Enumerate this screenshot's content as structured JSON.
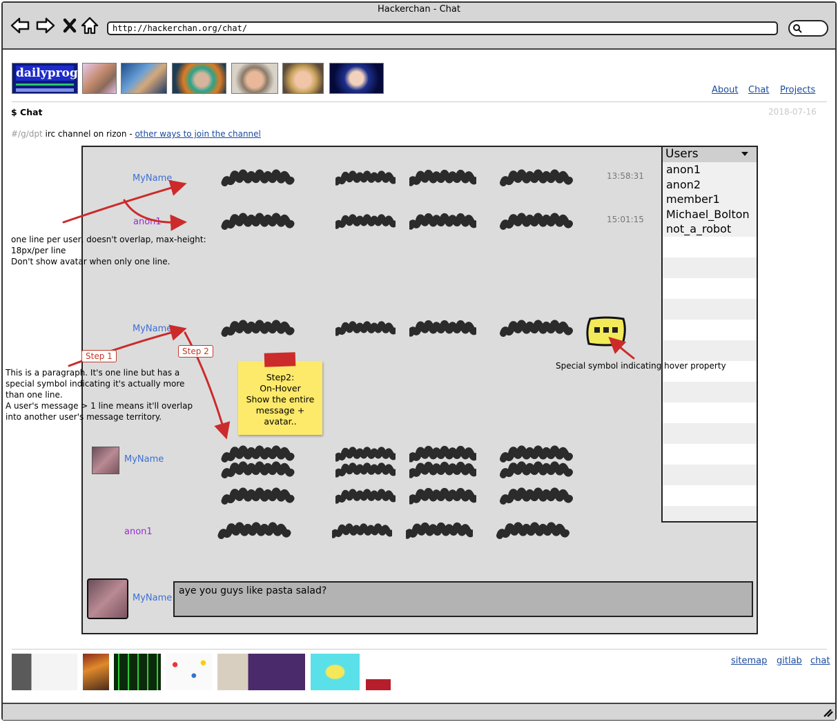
{
  "window": {
    "title": "Hackerchan - Chat",
    "url": "http://hackerchan.org/chat/"
  },
  "header": {
    "logo_text": "dailyprog",
    "nav": [
      {
        "label": "About"
      },
      {
        "label": "Chat"
      },
      {
        "label": "Projects"
      }
    ]
  },
  "page": {
    "title": "$ Chat",
    "date": "2018-07-16",
    "channel_prefix": "#/g/dpt",
    "channel_text": " irc channel on rizon - ",
    "channel_link": "other ways to join the channel"
  },
  "chat": {
    "messages": [
      {
        "name": "MyName",
        "time": "13:58:31"
      },
      {
        "name": "anon1",
        "time": "15:01:15"
      },
      {
        "name": "MyName"
      },
      {
        "name": "MyName"
      },
      {
        "name": "anon1"
      }
    ],
    "composer": {
      "name": "MyName",
      "value": "aye you guys like pasta salad?"
    }
  },
  "users": {
    "header": "Users",
    "list": [
      "anon1",
      "anon2",
      "member1",
      "Michael_Bolton",
      "not_a_robot"
    ]
  },
  "annotations": {
    "note1_line1": "one line per user, doesn't overlap, max-height:",
    "note1_line2": "18px/per line",
    "note1_line3": "Don't show avatar when only one line.",
    "note2_line1": "This is a paragraph. It's one line but has a",
    "note2_line2": "special symbol indicating it's actually more",
    "note2_line3": "than one line.",
    "note2_line4": "A user's message > 1 line means it'll overlap",
    "note2_line5": "into another user's message territory.",
    "step1": "Step 1",
    "step2": "Step 2",
    "sticky_line1": "Step2:",
    "sticky_line2": "On-Hover",
    "sticky_line3": "Show the entire",
    "sticky_line4": "message +",
    "sticky_line5": "avatar..",
    "hover_note": "Special symbol indicating hover property"
  },
  "footer": {
    "links": [
      {
        "label": "sitemap"
      },
      {
        "label": "gitlab"
      },
      {
        "label": "chat"
      }
    ]
  }
}
